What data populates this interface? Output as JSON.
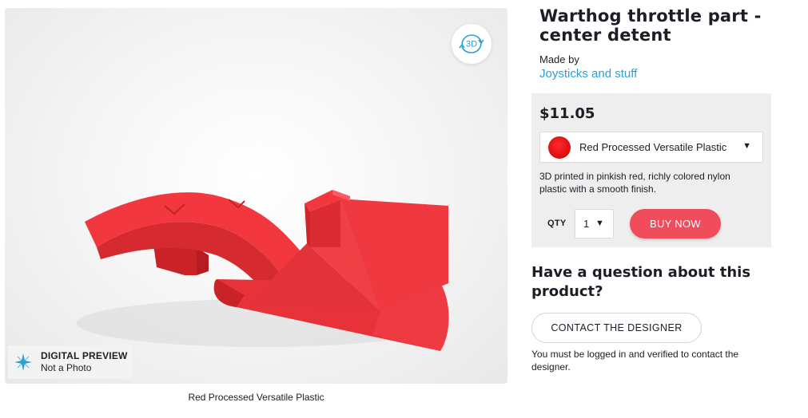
{
  "viewer": {
    "btn_3d_label": "3D",
    "btn_3d_icon": "rotate-3d-icon",
    "badge_icon": "sparkle-icon",
    "badge_title": "DIGITAL PREVIEW",
    "badge_subtitle": "Not a Photo",
    "caption": "Red Processed Versatile Plastic",
    "model_color": "#f2383e"
  },
  "product": {
    "title": "Warthog throttle part - center detent",
    "made_by_label": "Made by",
    "made_by_link": "Joysticks and stuff"
  },
  "buy": {
    "price": "$11.05",
    "material": "Red Processed Versatile Plastic",
    "swatch_color": "#e01010",
    "description": "3D printed in pinkish red, richly colored nylon plastic with a smooth finish.",
    "qty_label": "QTY",
    "qty_value": "1",
    "buy_label": "BUY NOW",
    "buy_color": "#f04c5c"
  },
  "contact": {
    "question": "Have a question about this product?",
    "button_label": "CONTACT THE DESIGNER",
    "note": "You must be logged in and verified to contact the designer."
  },
  "colors": {
    "link": "#2aa0d6",
    "text": "#1d1d26",
    "panel": "#eeeeef"
  }
}
